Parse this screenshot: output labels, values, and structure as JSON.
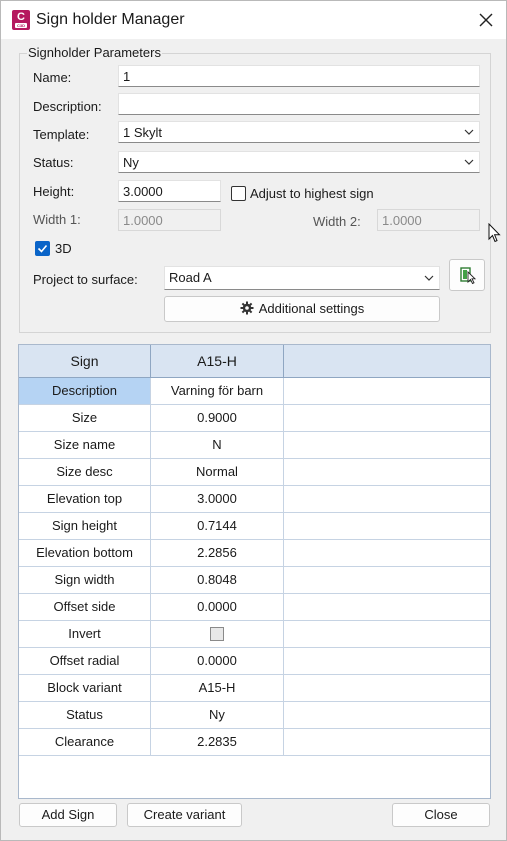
{
  "window": {
    "title": "Sign holder Manager",
    "app_icon_letter": "C",
    "app_icon_sub": "C3D"
  },
  "params": {
    "group_title": "Signholder Parameters",
    "name_label": "Name:",
    "name_value": "1",
    "description_label": "Description:",
    "description_value": "",
    "template_label": "Template:",
    "template_value": "1 Skylt",
    "status_label": "Status:",
    "status_value": "Ny",
    "height_label": "Height:",
    "height_value": "3.0000",
    "adjust_label": "Adjust to highest sign",
    "adjust_checked": false,
    "width1_label": "Width 1:",
    "width1_value": "1.0000",
    "width2_label": "Width 2:",
    "width2_value": "1.0000",
    "three_d_label": "3D",
    "three_d_checked": true,
    "project_label": "Project to surface:",
    "project_value": "Road A",
    "additional_label": "Additional settings"
  },
  "grid": {
    "headers": [
      "Sign",
      "A15-H",
      ""
    ],
    "rows": [
      {
        "label": "Description",
        "value": "Varning för barn"
      },
      {
        "label": "Size",
        "value": "0.9000"
      },
      {
        "label": "Size name",
        "value": "N"
      },
      {
        "label": "Size desc",
        "value": "Normal"
      },
      {
        "label": "Elevation top",
        "value": "3.0000"
      },
      {
        "label": "Sign height",
        "value": "0.7144"
      },
      {
        "label": "Elevation bottom",
        "value": "2.2856"
      },
      {
        "label": "Sign width",
        "value": "0.8048"
      },
      {
        "label": "Offset side",
        "value": "0.0000"
      },
      {
        "label": "Invert",
        "value": ""
      },
      {
        "label": "Offset radial",
        "value": "0.0000"
      },
      {
        "label": "Block variant",
        "value": "A15-H"
      },
      {
        "label": "Status",
        "value": "Ny"
      },
      {
        "label": "Clearance",
        "value": "2.2835"
      }
    ]
  },
  "footer": {
    "add_sign": "Add Sign",
    "create_variant": "Create variant",
    "close": "Close"
  },
  "colors": {
    "accent": "#0a64c8",
    "selected_cell": "#b5d3f3",
    "header_bg": "#d9e4f2",
    "app_icon": "#b5195f"
  }
}
